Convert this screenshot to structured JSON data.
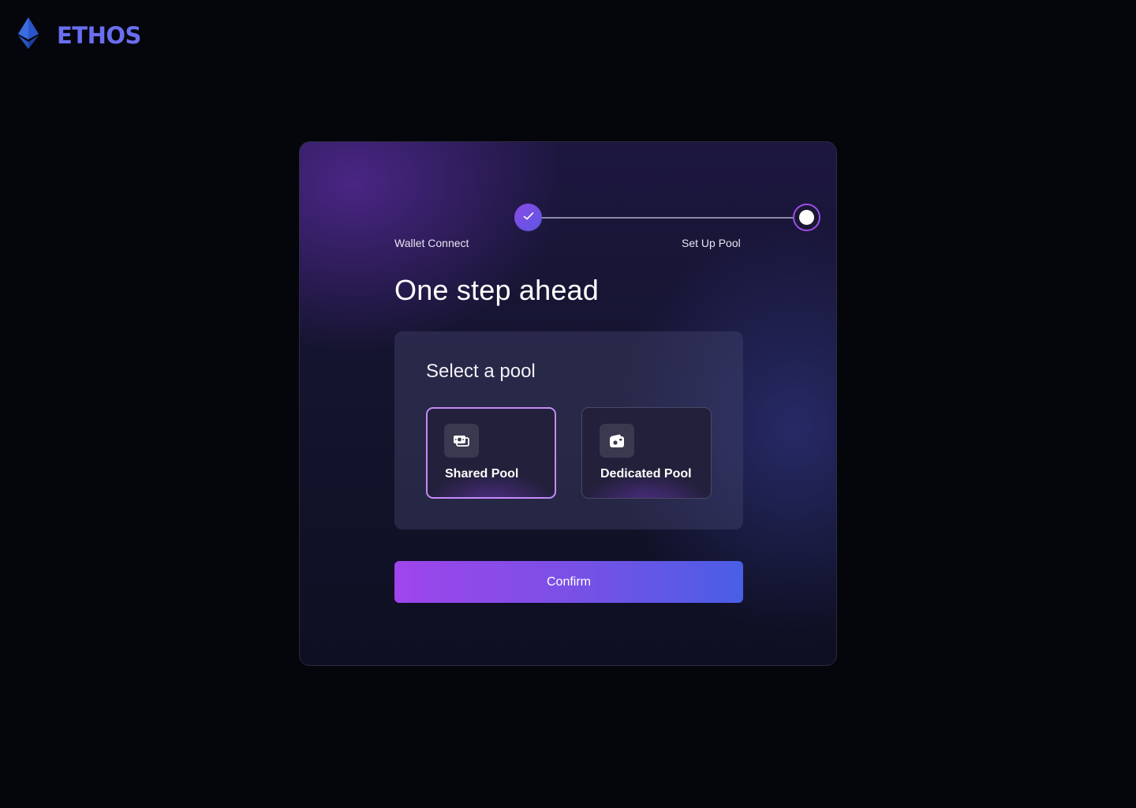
{
  "brand": {
    "name": "ETHOS",
    "logo_icon": "ethereum-diamond-icon",
    "color": "#6a6ef0"
  },
  "stepper": {
    "steps": [
      {
        "label": "Wallet Connect",
        "status": "completed",
        "icon": "check-icon"
      },
      {
        "label": "Set Up Pool",
        "status": "current"
      }
    ]
  },
  "main": {
    "title": "One step ahead",
    "pool_section": {
      "heading": "Select a pool",
      "options": [
        {
          "label": "Shared Pool",
          "icon": "shared-pool-icon",
          "selected": true
        },
        {
          "label": "Dedicated Pool",
          "icon": "dedicated-pool-icon",
          "selected": false
        }
      ]
    },
    "confirm_label": "Confirm"
  },
  "colors": {
    "accent_purple": "#9f45ec",
    "accent_blue": "#4a5ee6",
    "selected_border": "#c48cf7"
  }
}
